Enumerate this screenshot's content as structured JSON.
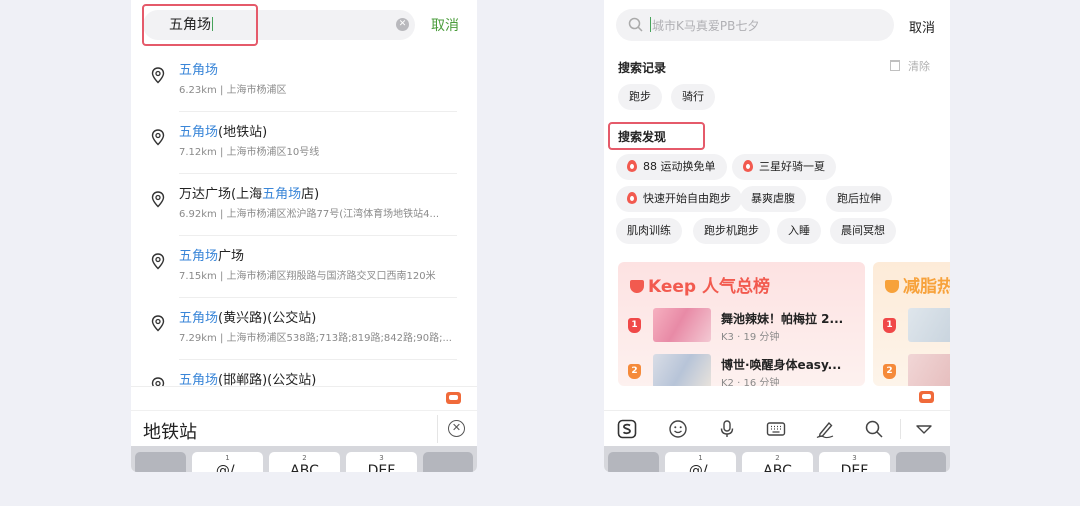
{
  "left": {
    "search_query": "五角场",
    "cancel_label": "取消",
    "results": [
      {
        "title_hl": "五角场",
        "title_rest": "",
        "title_pre": "",
        "sub": "6.23km | 上海市杨浦区"
      },
      {
        "title_hl": "五角场",
        "title_rest": "(地铁站)",
        "title_pre": "",
        "sub": "7.12km | 上海市杨浦区10号线"
      },
      {
        "title_hl": "五角场",
        "title_rest": "店)",
        "title_pre": "万达广场(上海",
        "sub": "6.92km | 上海市杨浦区淞沪路77号(江湾体育场地铁站4..."
      },
      {
        "title_hl": "五角场",
        "title_rest": "广场",
        "title_pre": "",
        "sub": "7.15km | 上海市杨浦区翔殷路与国济路交叉口西南120米"
      },
      {
        "title_hl": "五角场",
        "title_rest": "(黄兴路)(公交站)",
        "title_pre": "",
        "sub": "7.29km | 上海市杨浦区538路;713路;819路;842路;90路;..."
      },
      {
        "title_hl": "五角场",
        "title_rest": "(邯郸路)(公交站)",
        "title_pre": "",
        "sub": ""
      }
    ],
    "candidate": "地铁站",
    "keys": [
      {
        "num": "",
        "label": ""
      },
      {
        "num": "1",
        "label": "@/."
      },
      {
        "num": "2",
        "label": "ABC"
      },
      {
        "num": "3",
        "label": "DEF"
      },
      {
        "num": "",
        "label": ""
      }
    ]
  },
  "right": {
    "placeholder": "城市K马真爱PB七夕",
    "cancel_label": "取消",
    "history_title": "搜索记录",
    "clear_label": "清除",
    "history_chips": [
      "跑步",
      "骑行"
    ],
    "discover_title": "搜索发现",
    "discover_chips": [
      {
        "label": "88 运动换免单",
        "hot": true
      },
      {
        "label": "三星好骑一夏",
        "hot": true
      },
      {
        "label": "快速开始自由跑步",
        "hot": true
      },
      {
        "label": "暴爽虐腹",
        "hot": false
      },
      {
        "label": "跑后拉伸",
        "hot": false
      },
      {
        "label": "肌肉训练",
        "hot": false
      },
      {
        "label": "跑步机跑步",
        "hot": false
      },
      {
        "label": "入睡",
        "hot": false
      },
      {
        "label": "晨间冥想",
        "hot": false
      }
    ],
    "rank1": {
      "title": "Keep 人气总榜",
      "items": [
        {
          "rank": "1",
          "name": "舞池辣妹！帕梅拉 2...",
          "meta": "K3 · 19 分钟"
        },
        {
          "rank": "2",
          "name": "博世·唤醒身体easy...",
          "meta": "K2 · 16 分钟"
        }
      ]
    },
    "rank2": {
      "title": "减脂热",
      "items": [
        {
          "rank": "1"
        },
        {
          "rank": "2"
        }
      ]
    },
    "keys": [
      {
        "num": "",
        "label": ""
      },
      {
        "num": "1",
        "label": "@/."
      },
      {
        "num": "2",
        "label": "ABC"
      },
      {
        "num": "3",
        "label": "DEF"
      },
      {
        "num": "",
        "label": ""
      }
    ]
  },
  "colors": {
    "accent_green": "#4b9d3c",
    "highlight_blue": "#3a86d8",
    "keep_red": "#f25a4f",
    "annotation_box": "#e55a6a"
  }
}
